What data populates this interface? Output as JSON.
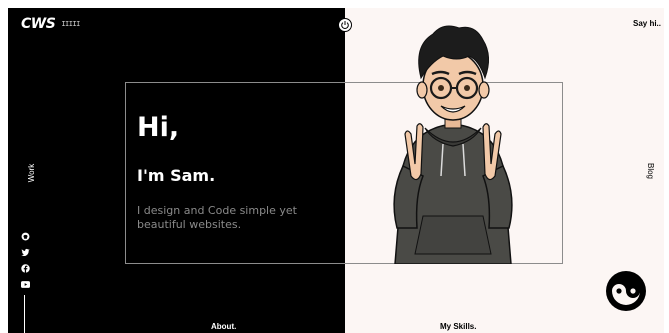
{
  "logo": {
    "text": "CWS",
    "signature": "IIIII"
  },
  "nav": {
    "say_hi": "Say hi..",
    "work": "Work",
    "blog": "Blog",
    "about": "About.",
    "skills": "My Skills."
  },
  "intro": {
    "greeting": "Hi,",
    "name_line": "I'm Sam.",
    "tagline": "I design and Code simple yet beautiful websites."
  },
  "socials": [
    {
      "icon": "github-icon"
    },
    {
      "icon": "twitter-icon"
    },
    {
      "icon": "facebook-icon"
    },
    {
      "icon": "youtube-icon"
    }
  ],
  "colors": {
    "left_bg": "#000000",
    "right_bg": "#fcf6f4",
    "box_border": "#8c8c8c",
    "tagline": "#8a8a8a",
    "hoodie": "#4a4a46"
  }
}
